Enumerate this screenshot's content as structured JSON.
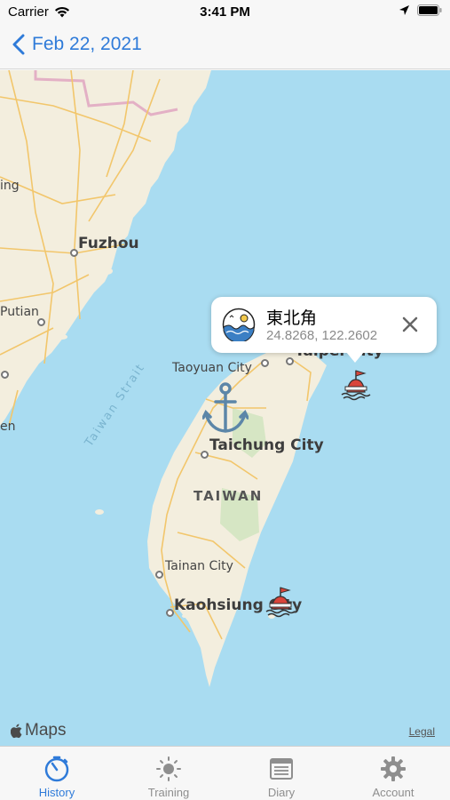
{
  "status_bar": {
    "carrier": "Carrier",
    "time": "3:41 PM",
    "icons": [
      "wifi-icon",
      "location-arrow-icon",
      "battery-icon"
    ]
  },
  "nav": {
    "back_label": "Feb 22, 2021",
    "back_icon": "chevron-left-icon",
    "accent_color": "#2f7bd9"
  },
  "map": {
    "labels": {
      "fuzhou": "Fuzhou",
      "putian": "Putian",
      "ing": "ing",
      "en": "en",
      "taiwan_strait": "Taiwan Strait",
      "taoyuan": "Taoyuan City",
      "taipei": "Taipei City",
      "taichung": "Taichung City",
      "taiwan": "TAIWAN",
      "tainan": "Tainan City",
      "kaohsiung": "Kaohsiung City"
    },
    "markers": [
      "anchor-icon",
      "buoy-icon",
      "buoy-icon"
    ],
    "attribution": "Maps",
    "legal": "Legal"
  },
  "callout": {
    "title": "東北角",
    "coords": "24.8268, 122.2602",
    "icon": "sea-wave-icon",
    "close_icon": "close-icon"
  },
  "tabs": [
    {
      "label": "History",
      "icon": "stopwatch-icon",
      "active": true
    },
    {
      "label": "Training",
      "icon": "sun-icon",
      "active": false
    },
    {
      "label": "Diary",
      "icon": "notebook-icon",
      "active": false
    },
    {
      "label": "Account",
      "icon": "gear-icon",
      "active": false
    }
  ]
}
